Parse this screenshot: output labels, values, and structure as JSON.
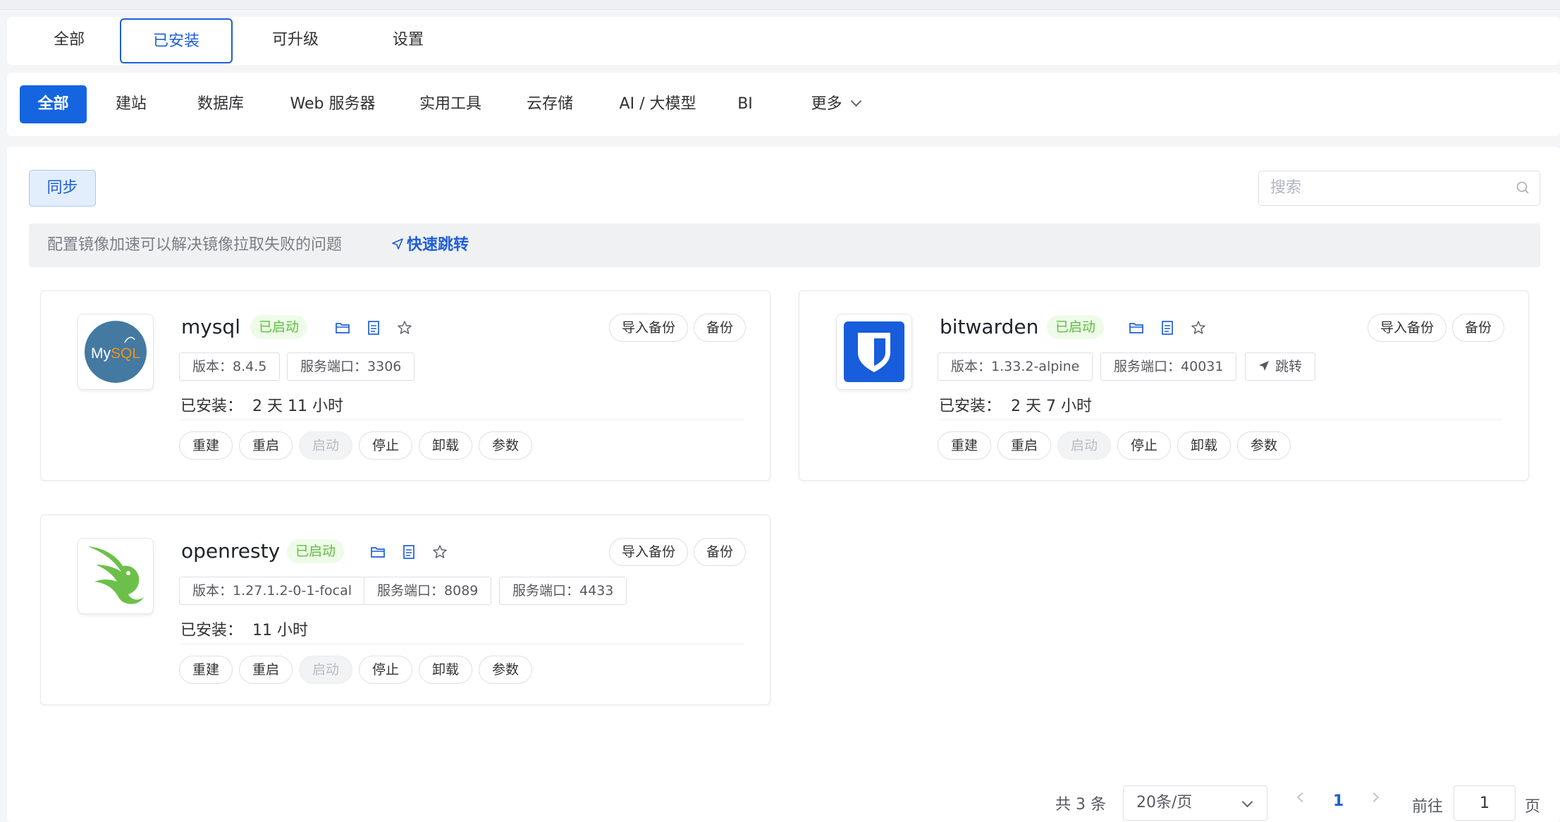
{
  "top_tabs": [
    "全部",
    "已安装",
    "可升级",
    "设置"
  ],
  "categories": [
    "全部",
    "建站",
    "数据库",
    "Web 服务器",
    "实用工具",
    "云存储",
    "AI / 大模型",
    "BI",
    "更多"
  ],
  "toolbar": {
    "sync_label": "同步",
    "search_placeholder": "搜索"
  },
  "notice": {
    "message": "配置镜像加速可以解决镜像拉取失败的问题",
    "link": "快速跳转"
  },
  "apps": [
    {
      "name": "mysql",
      "status": "已启动",
      "tags": [
        {
          "label": "版本：",
          "value": "8.4.5"
        },
        {
          "label": "服务端口：",
          "value": "3306"
        }
      ],
      "installed_label": "已安装：",
      "installed_time": "2 天 11 小时",
      "logo_text": "MySQL"
    },
    {
      "name": "bitwarden",
      "status": "已启动",
      "tags": [
        {
          "label": "版本：",
          "value": "1.33.2-alpine"
        },
        {
          "label": "服务端口：",
          "value": "40031"
        }
      ],
      "jump_label": "跳转",
      "installed_label": "已安装：",
      "installed_time": "2 天 7 小时"
    },
    {
      "name": "openresty",
      "status": "已启动",
      "tags": [
        {
          "label": "版本：",
          "value": "1.27.1.2-0-1-focal"
        },
        {
          "label": "服务端口：",
          "value": "8089"
        },
        {
          "label": "服务端口：",
          "value": "4433"
        }
      ],
      "installed_label": "已安装：",
      "installed_time": "11 小时"
    }
  ],
  "card_buttons": {
    "import_backup": "导入备份",
    "backup": "备份"
  },
  "actions": [
    "重建",
    "重启",
    "启动",
    "停止",
    "卸载",
    "参数"
  ],
  "pagination": {
    "total": "共 3 条",
    "page_size": "20条/页",
    "current": "1",
    "goto_prefix": "前往",
    "goto_value": "1",
    "goto_suffix": "页"
  },
  "colors": {
    "primary": "#1565e0",
    "status_green": "#5cbf3e",
    "bitwarden_blue": "#175ddc",
    "mysql_blue": "#4479a1",
    "openresty_green": "#6cc04a"
  }
}
